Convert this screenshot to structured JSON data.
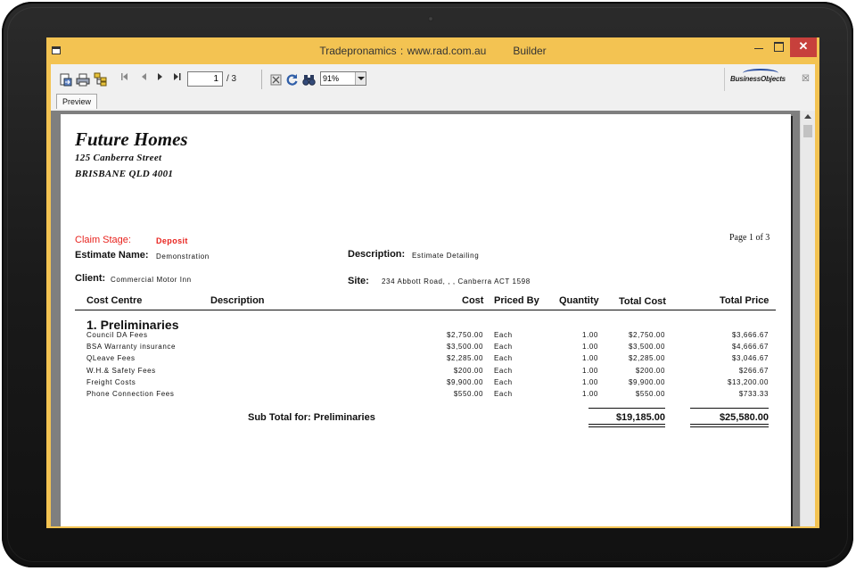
{
  "window": {
    "title_app": "Tradepronamics :",
    "title_url": "www.rad.com.au",
    "title_module": "Builder",
    "close_glyph": "✕"
  },
  "toolbar": {
    "icons": [
      "export-icon",
      "print-icon",
      "group-tree-icon",
      "first-page-icon",
      "prev-page-icon",
      "next-page-icon",
      "last-page-icon",
      "stop-icon",
      "refresh-icon",
      "search-icon"
    ],
    "current_page": "1",
    "total_pages": "/ 3",
    "zoom": "91%",
    "brand": "BusinessObjects",
    "close_glyph": "☒"
  },
  "tabs": [
    {
      "label": "Preview"
    }
  ],
  "report": {
    "company": "Future Homes",
    "address_line1": "125 Canberra Street",
    "address_line2": "BRISBANE  QLD 4001",
    "claim_stage_label": "Claim Stage:",
    "claim_stage_value": "Deposit",
    "page_of": "Page 1 of 3",
    "estimate_name_label": "Estimate Name:",
    "estimate_name_value": "Demonstration",
    "description_label": "Description:",
    "description_value": "Estimate Detailing",
    "client_label": "Client:",
    "client_value": "Commercial Motor Inn",
    "site_label": "Site:",
    "site_value": "234 Abbott Road, , , Canberra  ACT 1598",
    "columns": {
      "cost_centre": "Cost Centre",
      "description": "Description",
      "cost": "Cost",
      "priced_by": "Priced By",
      "quantity": "Quantity",
      "total_cost": "Total Cost",
      "total_price": "Total Price"
    },
    "section_title": "1. Preliminaries",
    "rows": [
      {
        "name": "Council DA Fees",
        "cost": "$2,750.00",
        "priced_by": "Each",
        "qty": "1.00",
        "total_cost": "$2,750.00",
        "total_price": "$3,666.67"
      },
      {
        "name": "BSA Warranty insurance",
        "cost": "$3,500.00",
        "priced_by": "Each",
        "qty": "1.00",
        "total_cost": "$3,500.00",
        "total_price": "$4,666.67"
      },
      {
        "name": "QLeave Fees",
        "cost": "$2,285.00",
        "priced_by": "Each",
        "qty": "1.00",
        "total_cost": "$2,285.00",
        "total_price": "$3,046.67"
      },
      {
        "name": "W.H.& Safety Fees",
        "cost": "$200.00",
        "priced_by": "Each",
        "qty": "1.00",
        "total_cost": "$200.00",
        "total_price": "$266.67"
      },
      {
        "name": "Freight Costs",
        "cost": "$9,900.00",
        "priced_by": "Each",
        "qty": "1.00",
        "total_cost": "$9,900.00",
        "total_price": "$13,200.00"
      },
      {
        "name": "Phone Connection Fees",
        "cost": "$550.00",
        "priced_by": "Each",
        "qty": "1.00",
        "total_cost": "$550.00",
        "total_price": "$733.33"
      }
    ],
    "subtotal_label": "Sub Total for: Preliminaries",
    "subtotal_cost": "$19,185.00",
    "subtotal_price": "$25,580.00"
  },
  "colors": {
    "window_frame": "#f3c352",
    "close_button": "#c7403c",
    "accent_red": "#e8231e"
  }
}
